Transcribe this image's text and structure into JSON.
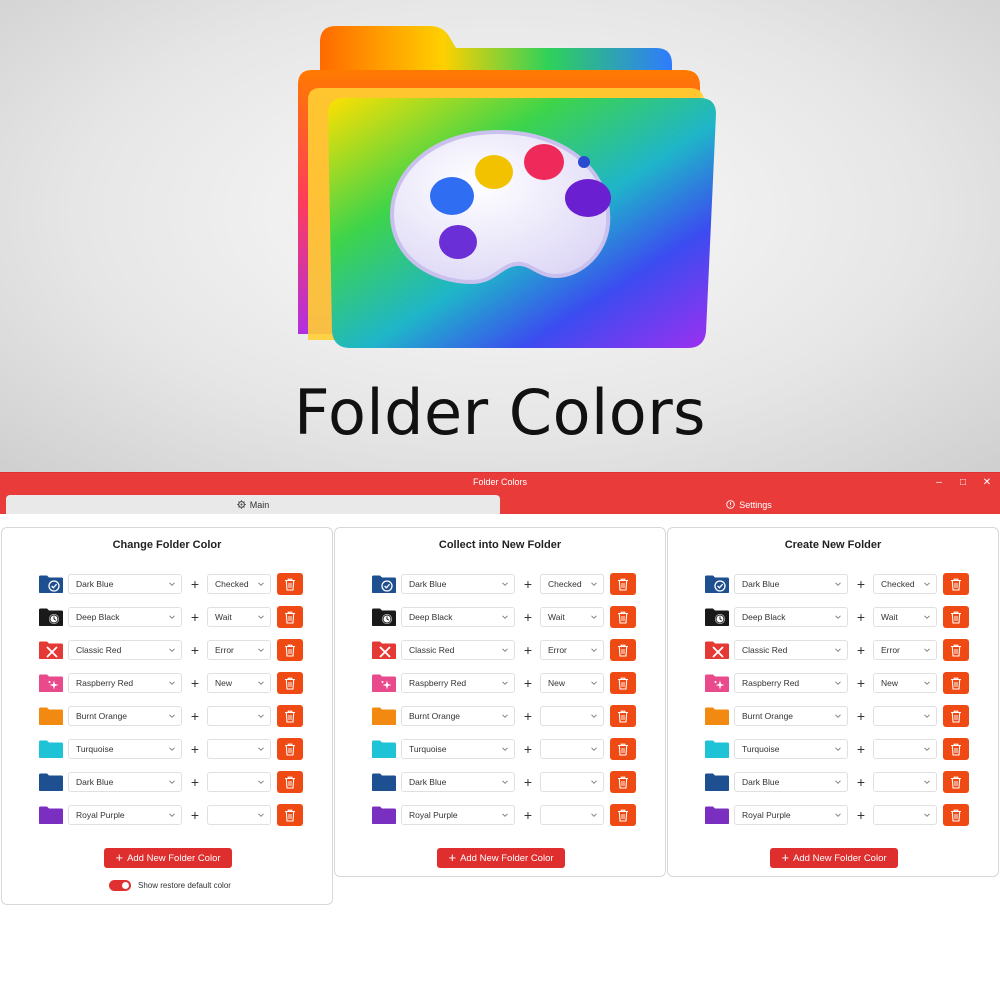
{
  "hero": {
    "title": "Folder Colors",
    "logo_icon": "rainbow-folder-palette-icon"
  },
  "window": {
    "title": "Folder Colors",
    "controls": {
      "minimize": "–",
      "maximize": "□",
      "close": "✕"
    }
  },
  "tabs": [
    {
      "label": "Main",
      "icon": "gear-icon",
      "active": true
    },
    {
      "label": "Settings",
      "icon": "info-icon",
      "active": false
    }
  ],
  "panels": [
    {
      "title": "Change Folder Color",
      "add_button": "Add New Folder Color",
      "toggle_label": "Show restore default color",
      "toggle_on": true,
      "rows": [
        {
          "color": "Dark Blue",
          "status": "Checked"
        },
        {
          "color": "Deep Black",
          "status": "Wait"
        },
        {
          "color": "Classic Red",
          "status": "Error"
        },
        {
          "color": "Raspberry Red",
          "status": "New"
        },
        {
          "color": "Burnt Orange",
          "status": ""
        },
        {
          "color": "Turquoise",
          "status": ""
        },
        {
          "color": "Dark Blue",
          "status": ""
        },
        {
          "color": "Royal Purple",
          "status": ""
        }
      ]
    },
    {
      "title": "Collect into New Folder",
      "add_button": "Add New Folder Color",
      "rows": [
        {
          "color": "Dark Blue",
          "status": "Checked"
        },
        {
          "color": "Deep Black",
          "status": "Wait"
        },
        {
          "color": "Classic Red",
          "status": "Error"
        },
        {
          "color": "Raspberry Red",
          "status": "New"
        },
        {
          "color": "Burnt Orange",
          "status": ""
        },
        {
          "color": "Turquoise",
          "status": ""
        },
        {
          "color": "Dark Blue",
          "status": ""
        },
        {
          "color": "Royal Purple",
          "status": ""
        }
      ]
    },
    {
      "title": "Create New Folder",
      "add_button": "Add New Folder Color",
      "rows": [
        {
          "color": "Dark Blue",
          "status": "Checked"
        },
        {
          "color": "Deep Black",
          "status": "Wait"
        },
        {
          "color": "Classic Red",
          "status": "Error"
        },
        {
          "color": "Raspberry Red",
          "status": "New"
        },
        {
          "color": "Burnt Orange",
          "status": ""
        },
        {
          "color": "Turquoise",
          "status": ""
        },
        {
          "color": "Dark Blue",
          "status": ""
        },
        {
          "color": "Royal Purple",
          "status": ""
        }
      ]
    }
  ],
  "folder_swatches": [
    {
      "name": "Dark Blue",
      "hex": "#1d4f91",
      "badge": "check-icon"
    },
    {
      "name": "Deep Black",
      "hex": "#1a1a1a",
      "badge": "clock-icon"
    },
    {
      "name": "Classic Red",
      "hex": "#e53935",
      "badge": "x-icon"
    },
    {
      "name": "Raspberry Red",
      "hex": "#e84a8c",
      "badge": "sparkle-icon"
    },
    {
      "name": "Burnt Orange",
      "hex": "#f28a12",
      "badge": ""
    },
    {
      "name": "Turquoise",
      "hex": "#1ec3d6",
      "badge": ""
    },
    {
      "name": "Dark Blue",
      "hex": "#1d4f91",
      "badge": ""
    },
    {
      "name": "Royal Purple",
      "hex": "#7a2fbf",
      "badge": ""
    }
  ],
  "colors": {
    "accent": "#ea3b3b",
    "delete_button": "#f04a14",
    "add_button": "#de2e2e"
  }
}
